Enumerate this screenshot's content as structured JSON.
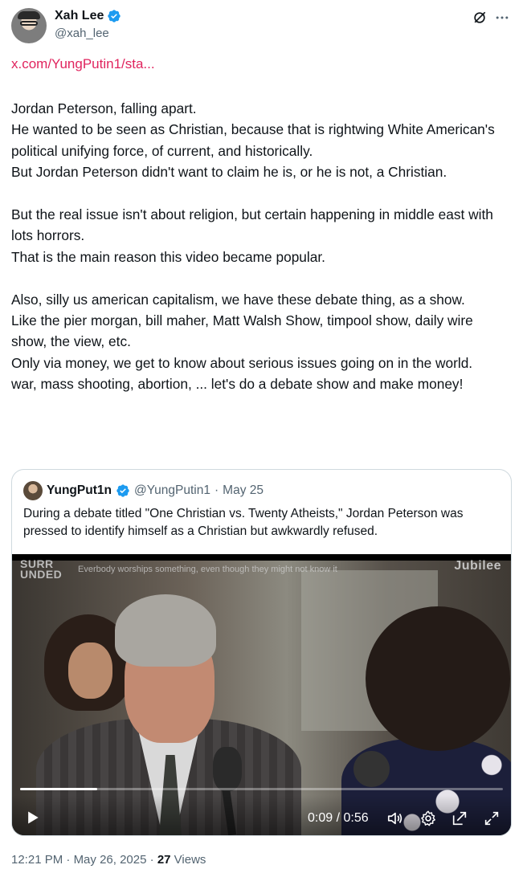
{
  "author": {
    "display_name": "Xah Lee",
    "handle": "@xah_lee"
  },
  "link_text": "x.com/YungPutin1/sta...",
  "tweet_paragraphs": [
    [
      "Jordan Peterson, falling apart.",
      "He wanted to be seen as Christian, because that is rightwing White American's political unifying force, of current, and historically.",
      "But Jordan Peterson didn't want to claim he is, or he is not, a Christian."
    ],
    [
      "But the real issue isn't about religion, but certain happening in middle east with lots horrors.",
      "That is the main reason this video became popular."
    ],
    [
      "Also, silly us american capitalism, we have these debate thing, as a show.",
      "Like the pier morgan, bill maher, Matt Walsh Show, timpool show, daily wire show, the view, etc.",
      "Only via money, we get to know about serious issues going on in the world.",
      "war, mass shooting, abortion, ... let's do a debate show and make money!"
    ]
  ],
  "quote": {
    "display_name": "YungPut1n",
    "handle": "@YungPutin1",
    "separator": "·",
    "date": "May 25",
    "text": "During a debate titled \"One Christian vs. Twenty Atheists,\" Jordan Peterson was pressed to identify himself as a Christian but awkwardly refused.",
    "video": {
      "logo_line1": "SURR",
      "logo_line2": "UNDED",
      "caption": "Everbody worships something, even though they might not know it",
      "brand": "Jubilee",
      "current_time": "0:09",
      "duration": "0:56",
      "time_display": "0:09 / 0:56",
      "progress_fraction": 0.16
    }
  },
  "meta": {
    "time": "12:21 PM",
    "separator": "·",
    "date": "May 26, 2025",
    "views_count": "27",
    "views_label": "Views"
  },
  "colors": {
    "link": "#e0245e",
    "verified": "#1d9bf0",
    "secondary_text": "#536471"
  },
  "icons": [
    "verified-badge-icon",
    "grok-icon",
    "more-icon",
    "play-icon",
    "volume-icon",
    "settings-icon",
    "pip-icon",
    "fullscreen-icon"
  ]
}
